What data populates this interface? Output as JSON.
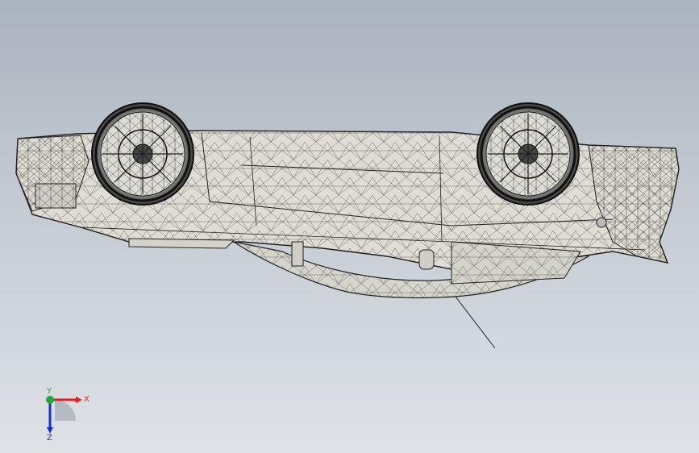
{
  "viewport": {
    "background_top": "#a9b3be",
    "background_bottom": "#dfe2e6",
    "model": {
      "name": "car-body-wireframe",
      "display_mode": "shaded-with-edges",
      "orientation": "upside-down",
      "body_color": "#dcdbd3",
      "edge_color": "#2a2a2a"
    }
  },
  "triad": {
    "x_label": "X",
    "y_label": "Y",
    "z_label": "Z",
    "x_color": "#e0201a",
    "y_color": "#22a83a",
    "z_color": "#1a2fd0"
  }
}
